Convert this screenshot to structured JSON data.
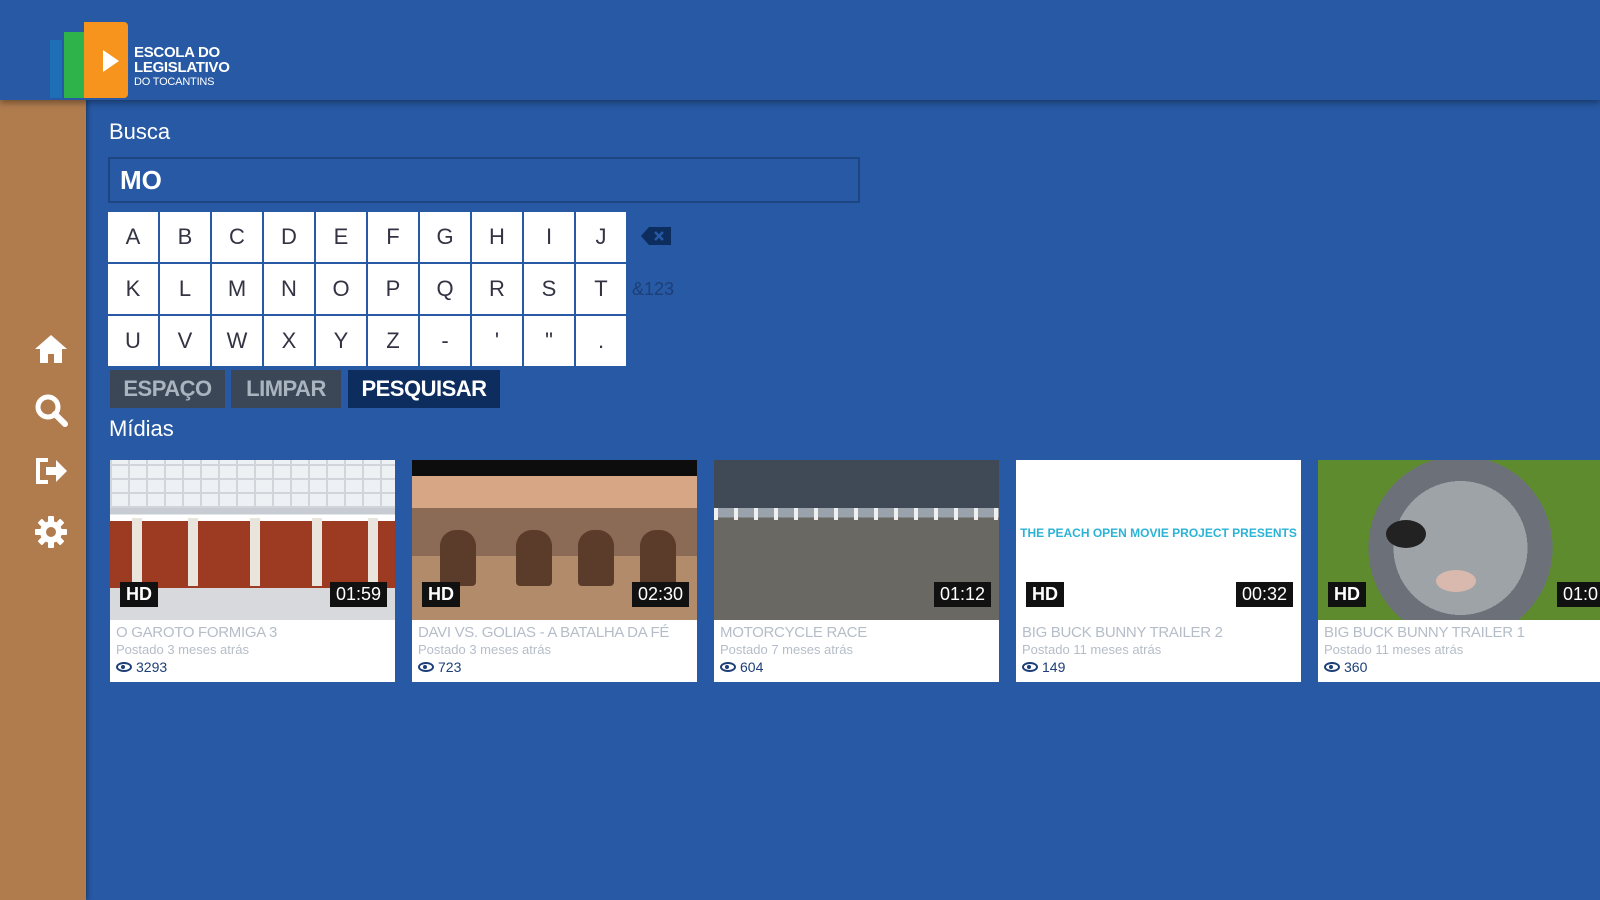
{
  "header": {
    "logo_line1": "ESCOLA DO",
    "logo_line2": "LEGISLATIVO",
    "logo_line3": "DO TOCANTINS"
  },
  "sidebar": {
    "items": [
      {
        "icon": "home-icon"
      },
      {
        "icon": "search-icon"
      },
      {
        "icon": "logout-icon"
      },
      {
        "icon": "gear-icon"
      }
    ]
  },
  "search": {
    "label": "Busca",
    "value": "MO"
  },
  "keyboard": {
    "rows": [
      [
        "A",
        "B",
        "C",
        "D",
        "E",
        "F",
        "G",
        "H",
        "I",
        "J"
      ],
      [
        "K",
        "L",
        "M",
        "N",
        "O",
        "P",
        "Q",
        "R",
        "S",
        "T"
      ],
      [
        "U",
        "V",
        "W",
        "X",
        "Y",
        "Z",
        "-",
        "'",
        "\"",
        "."
      ]
    ],
    "symbols_label": "&123",
    "space_label": "ESPAÇO",
    "clear_label": "LIMPAR",
    "search_label": "PESQUISAR"
  },
  "media": {
    "label": "Mídias",
    "items": [
      {
        "title": "O GAROTO FORMIGA 3",
        "posted": "Postado 3 meses atrás",
        "views": "3293",
        "quality": "HD",
        "duration": "01:59"
      },
      {
        "title": "DAVI VS. GOLIAS - A BATALHA DA FÉ",
        "posted": "Postado 3 meses atrás",
        "views": "723",
        "quality": "HD",
        "duration": "02:30"
      },
      {
        "title": "MOTORCYCLE RACE",
        "posted": "Postado 7 meses atrás",
        "views": "604",
        "quality": "",
        "duration": "01:12"
      },
      {
        "title": "BIG BUCK BUNNY TRAILER 2",
        "posted": "Postado 11 meses atrás",
        "views": "149",
        "quality": "HD",
        "duration": "00:32",
        "thumb_text": "THE PEACH OPEN MOVIE PROJECT PRESENTS"
      },
      {
        "title": "BIG BUCK BUNNY TRAILER 1",
        "posted": "Postado 11 meses atrás",
        "views": "360",
        "quality": "HD",
        "duration": "01:0"
      }
    ]
  },
  "colors": {
    "background": "#2759a4",
    "sidebar": "#b07c4e",
    "primary_button": "#0d2d5e",
    "secondary_button": "#3b4757"
  }
}
